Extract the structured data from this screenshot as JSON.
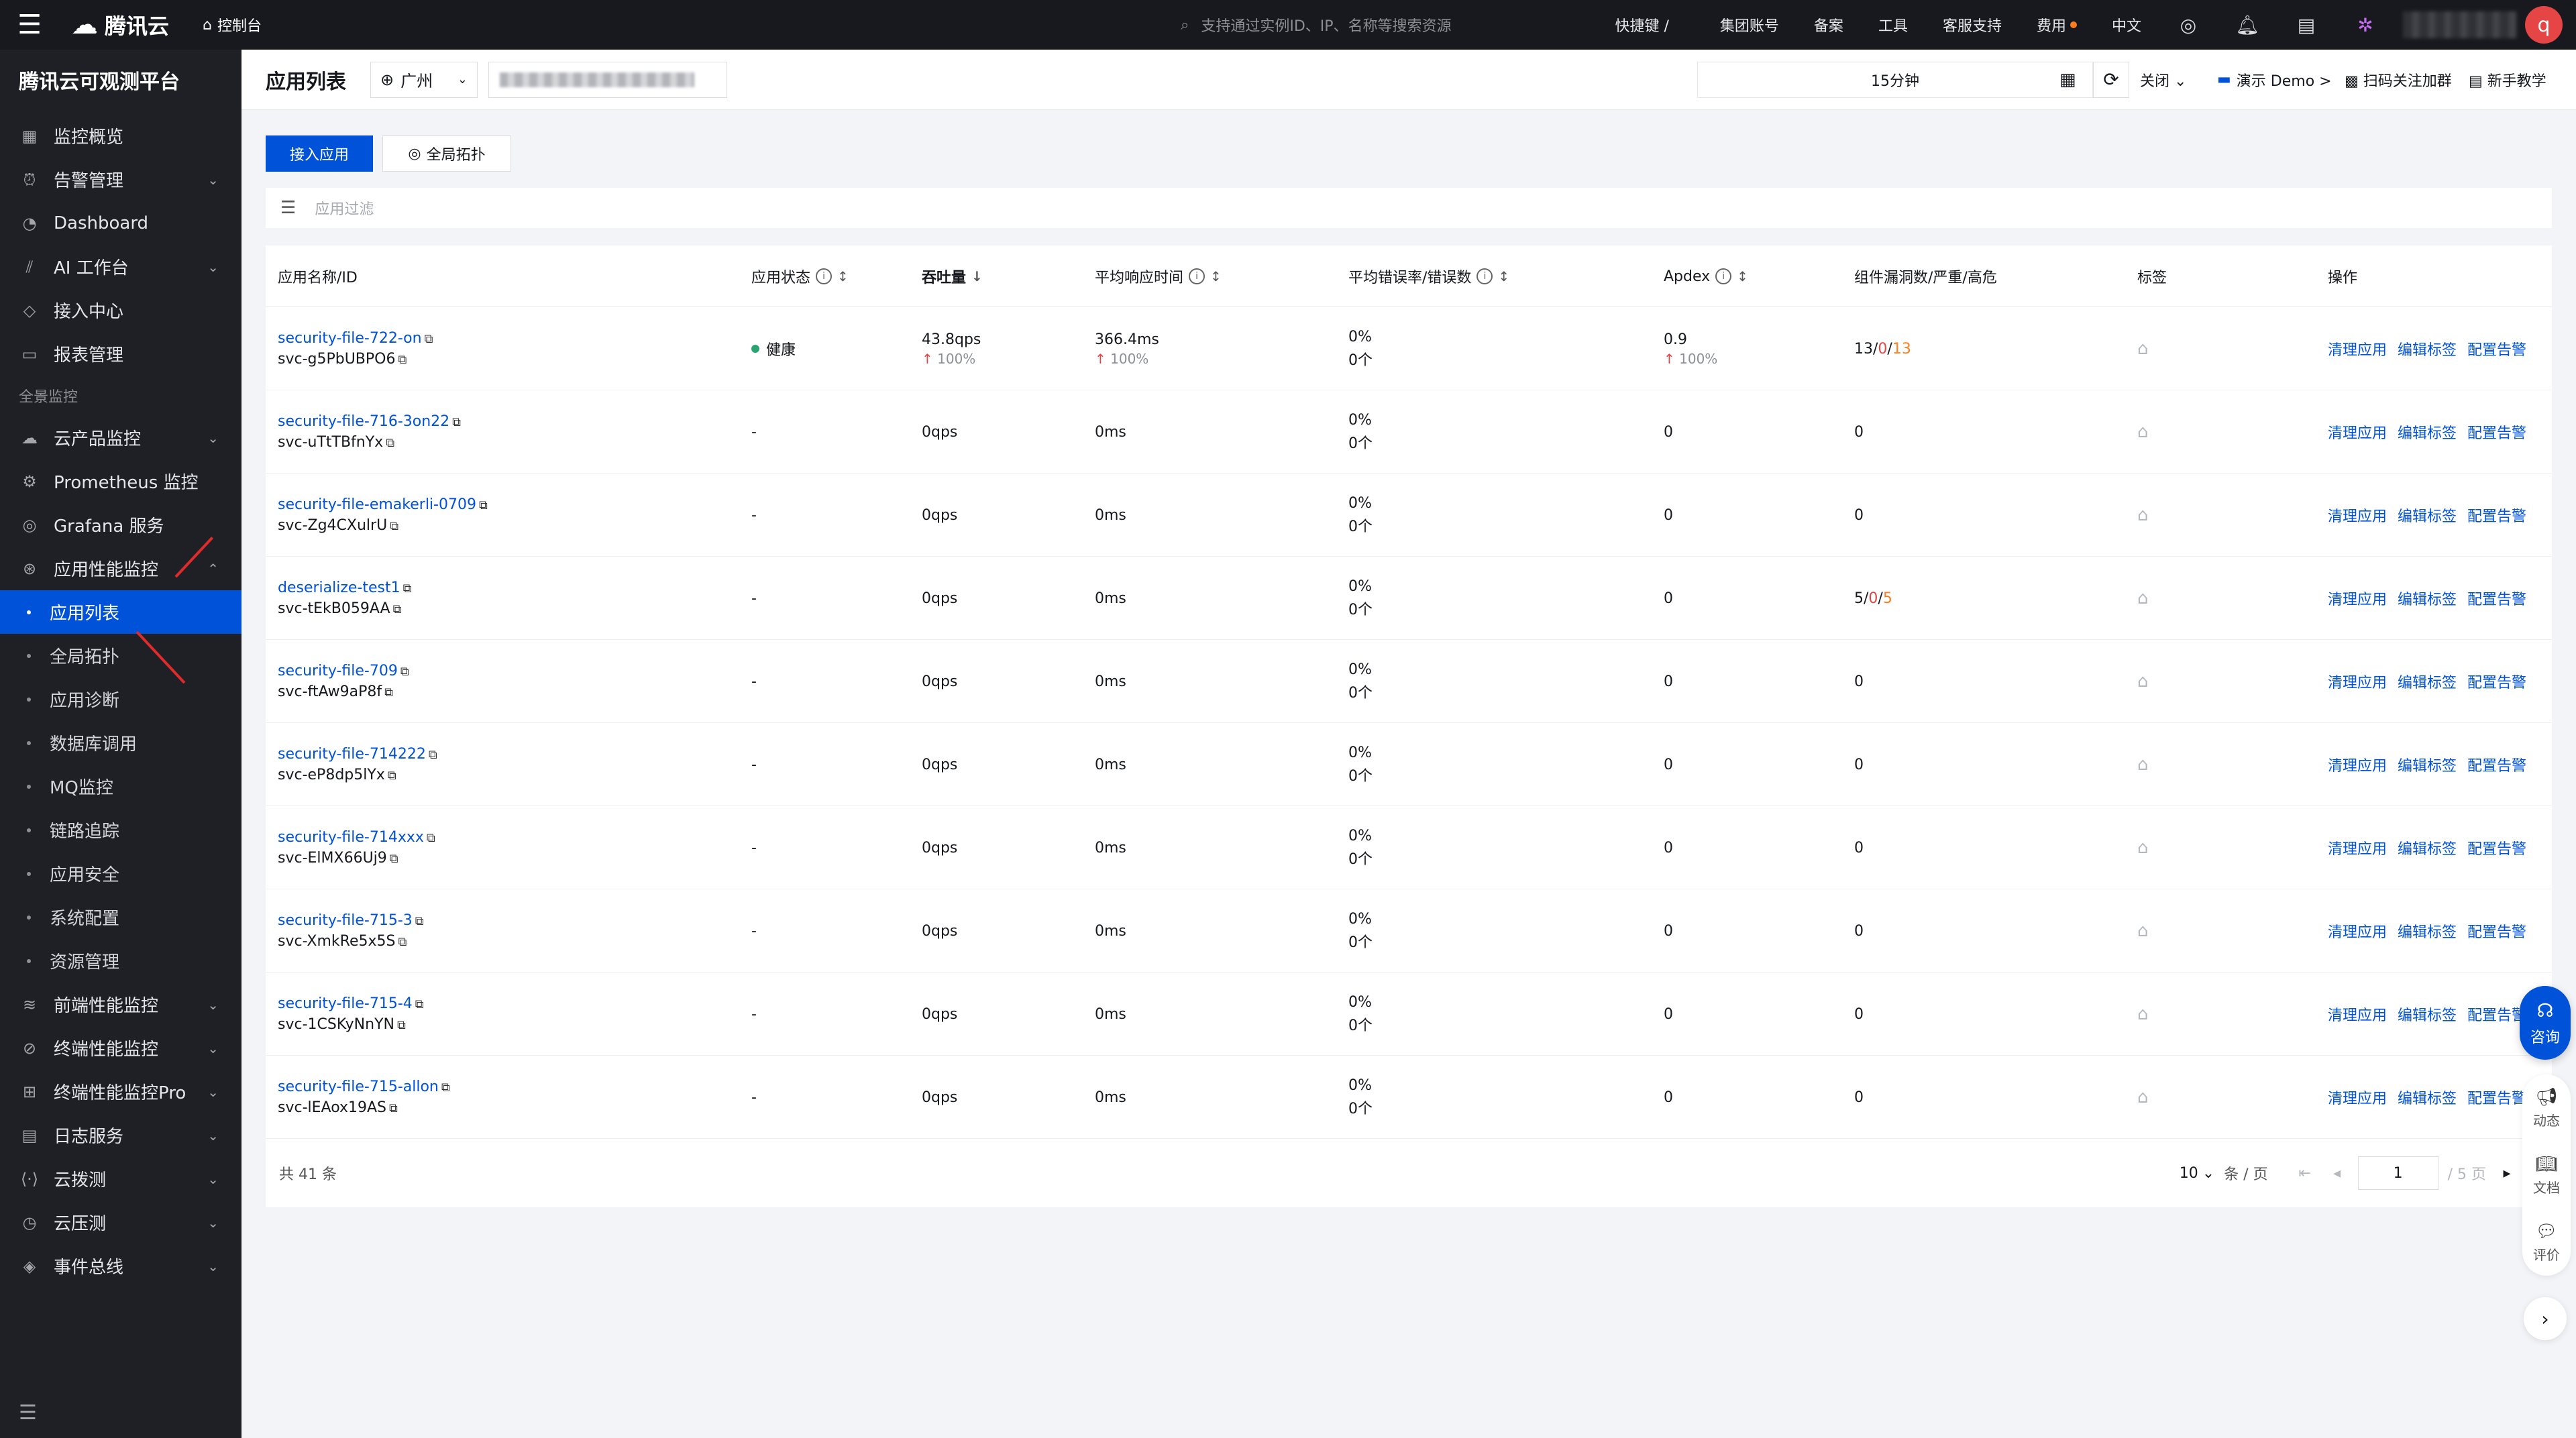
{
  "topbar": {
    "brand": "腾讯云",
    "console": "控制台",
    "search_placeholder": "支持通过实例ID、IP、名称等搜索资源",
    "shortcut": "快捷键 /",
    "items": [
      "集团账号",
      "备案",
      "工具",
      "客服支持",
      "费用",
      "中文"
    ],
    "avatar": "q"
  },
  "sidebar": {
    "title": "腾讯云可观测平台",
    "top_items": [
      {
        "label": "监控概览",
        "icon": "grid-icon"
      },
      {
        "label": "告警管理",
        "icon": "alarm-icon",
        "chevron": "⌄"
      },
      {
        "label": "Dashboard",
        "icon": "dashboard-icon"
      },
      {
        "label": "AI 工作台",
        "icon": "ai-icon",
        "chevron": "⌄"
      },
      {
        "label": "接入中心",
        "icon": "cube-icon"
      },
      {
        "label": "报表管理",
        "icon": "report-icon"
      }
    ],
    "section": "全景监控",
    "items": [
      {
        "label": "云产品监控",
        "icon": "cloud-icon",
        "chevron": "⌄"
      },
      {
        "label": "Prometheus 监控",
        "icon": "prometheus-icon"
      },
      {
        "label": "Grafana 服务",
        "icon": "grafana-icon"
      },
      {
        "label": "应用性能监控",
        "icon": "apm-icon",
        "chevron": "⌃"
      }
    ],
    "sub_items": [
      "应用列表",
      "全局拓扑",
      "应用诊断",
      "数据库调用",
      "MQ监控",
      "链路追踪",
      "应用安全",
      "系统配置",
      "资源管理"
    ],
    "bottom_items": [
      {
        "label": "前端性能监控",
        "icon": "rum-icon",
        "chevron": "⌄"
      },
      {
        "label": "终端性能监控",
        "icon": "terminal-icon",
        "chevron": "⌄"
      },
      {
        "label": "终端性能监控Pro",
        "icon": "terminal-pro-icon",
        "chevron": "⌄"
      },
      {
        "label": "日志服务",
        "icon": "log-icon",
        "chevron": "⌄"
      },
      {
        "label": "云拨测",
        "icon": "probe-icon",
        "chevron": "⌄"
      },
      {
        "label": "云压测",
        "icon": "pressure-icon",
        "chevron": "⌄"
      },
      {
        "label": "事件总线",
        "icon": "eventbus-icon",
        "chevron": "⌄"
      }
    ]
  },
  "header": {
    "title": "应用列表",
    "region": "广州",
    "time_range": "15分钟",
    "auto_refresh": "关闭",
    "demo": "演示 Demo >",
    "scan": "扫码关注加群",
    "tutorial": "新手教学"
  },
  "toolbar": {
    "primary": "接入应用",
    "secondary": "全局拓扑",
    "filter_placeholder": "应用过滤"
  },
  "table": {
    "columns": [
      "应用名称/ID",
      "应用状态",
      "吞吐量",
      "平均响应时间",
      "平均错误率/错误数",
      "Apdex",
      "组件漏洞数/严重/高危",
      "标签",
      "操作"
    ],
    "rows": [
      {
        "name": "security-file-722-on",
        "id": "svc-g5PbUBPO6",
        "status": "健康",
        "qps": "43.8qps",
        "qps_sub": "100%",
        "resp": "366.4ms",
        "resp_sub": "100%",
        "err_rate": "0%",
        "err_count": "0个",
        "apdex": "0.9",
        "apdex_sub": "100%",
        "vul_a": "13",
        "vul_b": "0",
        "vul_c": "13"
      },
      {
        "name": "security-file-716-3on22",
        "id": "svc-uTtTBfnYx",
        "status": "-",
        "qps": "0qps",
        "resp": "0ms",
        "err_rate": "0%",
        "err_count": "0个",
        "apdex": "0",
        "vul_a": "0"
      },
      {
        "name": "security-file-emakerli-0709",
        "id": "svc-Zg4CXulrU",
        "status": "-",
        "qps": "0qps",
        "resp": "0ms",
        "err_rate": "0%",
        "err_count": "0个",
        "apdex": "0",
        "vul_a": "0"
      },
      {
        "name": "deserialize-test1",
        "id": "svc-tEkB059AA",
        "status": "-",
        "qps": "0qps",
        "resp": "0ms",
        "err_rate": "0%",
        "err_count": "0个",
        "apdex": "0",
        "vul_a": "5",
        "vul_b": "0",
        "vul_c": "5"
      },
      {
        "name": "security-file-709",
        "id": "svc-ftAw9aP8f",
        "status": "-",
        "qps": "0qps",
        "resp": "0ms",
        "err_rate": "0%",
        "err_count": "0个",
        "apdex": "0",
        "vul_a": "0"
      },
      {
        "name": "security-file-714222",
        "id": "svc-eP8dp5lYx",
        "status": "-",
        "qps": "0qps",
        "resp": "0ms",
        "err_rate": "0%",
        "err_count": "0个",
        "apdex": "0",
        "vul_a": "0"
      },
      {
        "name": "security-file-714xxx",
        "id": "svc-ElMX66Uj9",
        "status": "-",
        "qps": "0qps",
        "resp": "0ms",
        "err_rate": "0%",
        "err_count": "0个",
        "apdex": "0",
        "vul_a": "0"
      },
      {
        "name": "security-file-715-3",
        "id": "svc-XmkRe5x5S",
        "status": "-",
        "qps": "0qps",
        "resp": "0ms",
        "err_rate": "0%",
        "err_count": "0个",
        "apdex": "0",
        "vul_a": "0"
      },
      {
        "name": "security-file-715-4",
        "id": "svc-1CSKyNnYN",
        "status": "-",
        "qps": "0qps",
        "resp": "0ms",
        "err_rate": "0%",
        "err_count": "0个",
        "apdex": "0",
        "vul_a": "0"
      },
      {
        "name": "security-file-715-allon",
        "id": "svc-lEAox19AS",
        "status": "-",
        "qps": "0qps",
        "resp": "0ms",
        "err_rate": "0%",
        "err_count": "0个",
        "apdex": "0",
        "vul_a": "0"
      }
    ],
    "actions": [
      "清理应用",
      "编辑标签",
      "配置告警"
    ],
    "total": "共 41 条",
    "page_size": "10",
    "page_size_unit": "条 / 页",
    "current_page": "1",
    "total_pages": "/ 5 页"
  },
  "floating": {
    "consult": "咨询",
    "items": [
      "动态",
      "文档",
      "评价"
    ]
  }
}
